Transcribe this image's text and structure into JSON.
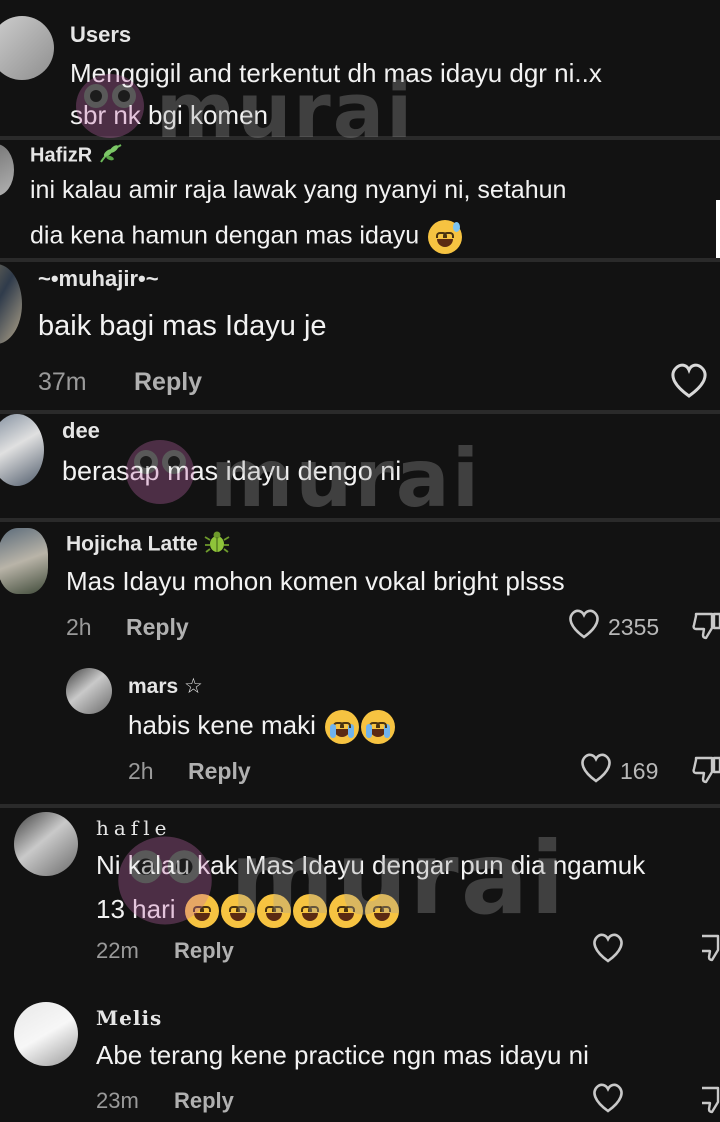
{
  "watermark": {
    "text": "murai"
  },
  "comments": [
    {
      "username": "Users",
      "text_line1": "Menggigil and terkentut dh mas idayu dgr ni..x",
      "text_line2": "sbr nk bgi komen"
    },
    {
      "username": "HafizR",
      "badge_icon": "leaf-icon",
      "text_line1": "ini kalau amir raja lawak yang nyanyi ni, setahun",
      "text_line2": "dia kena hamun dengan mas idayu",
      "emoji": "grinning-sweat-emoji"
    },
    {
      "username": "~•muhajir•~",
      "text": "baik bagi mas Idayu je",
      "time": "37m",
      "reply": "Reply"
    },
    {
      "username": "dee",
      "text": "berasap mas idayu dengo ni"
    },
    {
      "username": "Hojicha Latte",
      "badge_icon": "bug-icon",
      "text": "Mas Idayu mohon komen vokal bright plsss",
      "time": "2h",
      "reply": "Reply",
      "likes": "2355"
    },
    {
      "username": "mars ☆",
      "text": "habis kene maki",
      "emoji": "crying-emoji",
      "time": "2h",
      "reply": "Reply",
      "likes": "169"
    },
    {
      "username": "hafle",
      "text_line1": "Ni kalau kak Mas Idayu dengar pun dia ngamuk",
      "text_line2": "13 hari",
      "emoji": "laughing-tears-emoji",
      "time": "22m",
      "reply": "Reply"
    },
    {
      "username": "Melis",
      "text": "Abe terang kene practice ngn mas idayu ni",
      "time": "23m",
      "reply": "Reply"
    }
  ],
  "colors": {
    "background": "#121212",
    "text": "#f2f2f2",
    "muted": "#9a9a9a",
    "emoji": "#f6c341"
  }
}
